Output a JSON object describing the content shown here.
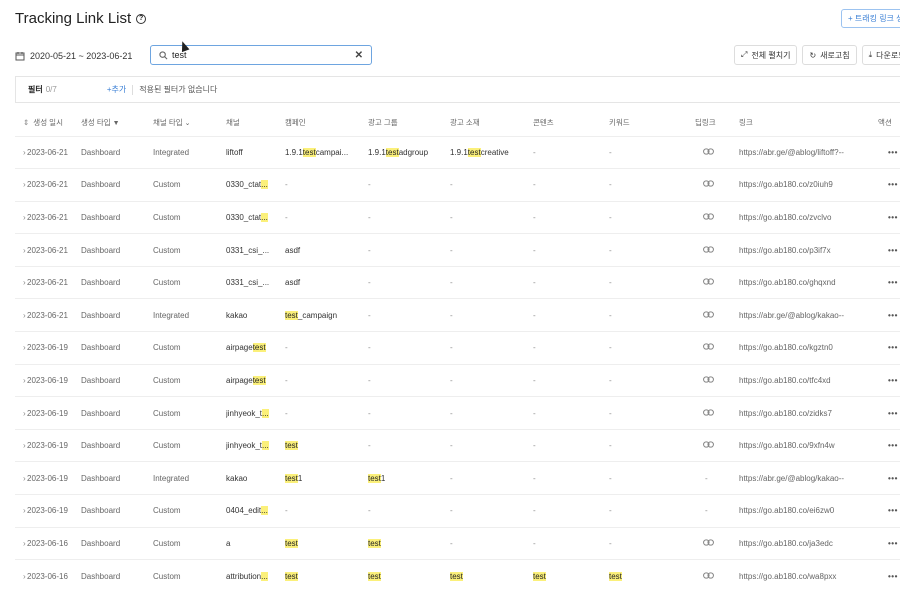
{
  "page": {
    "title": "Tracking Link List",
    "help_icon": "?"
  },
  "create_button": {
    "label": "+ 트래킹 링크 생"
  },
  "date_range": {
    "label": "2020-05-21  ~  2023-06-21"
  },
  "search": {
    "value": "test",
    "placeholder": ""
  },
  "toolbar": {
    "expand": "전체 펼치기",
    "refresh": "새로고침",
    "download": "다운로드"
  },
  "filter": {
    "label": "필터",
    "count": "0/7",
    "add": "+추가",
    "empty": "적용된 필터가 없습니다"
  },
  "columns": [
    "생성 일시",
    "생성 타입",
    "채널 타입",
    "채널",
    "캠페인",
    "광고 그룹",
    "광고 소재",
    "콘텐츠",
    "키워드",
    "딥링크",
    "링크",
    "액션"
  ],
  "rows": [
    {
      "date": "2023-06-21",
      "ctype": "Dashboard",
      "chtype": "Integrated",
      "channel": [
        "liftoff"
      ],
      "campaign": [
        "1.9.1",
        "test",
        "campai..."
      ],
      "group": [
        "1.9.1",
        "test",
        "adgroup"
      ],
      "creative": [
        "1.9.1",
        "test",
        "creative"
      ],
      "content": [
        "-"
      ],
      "keyword": [
        "-"
      ],
      "deeplink": "link",
      "url": "https://abr.ge/@ablog/liftoff?--",
      "action": "•••"
    },
    {
      "date": "2023-06-21",
      "ctype": "Dashboard",
      "chtype": "Custom",
      "channel": [
        "0330_ctat",
        "..."
      ],
      "campaign": [
        "-"
      ],
      "group": [
        "-"
      ],
      "creative": [
        "-"
      ],
      "content": [
        "-"
      ],
      "keyword": [
        "-"
      ],
      "deeplink": "link",
      "url": "https://go.ab180.co/z0iuh9",
      "action": "•••"
    },
    {
      "date": "2023-06-21",
      "ctype": "Dashboard",
      "chtype": "Custom",
      "channel": [
        "0330_ctat",
        "..."
      ],
      "campaign": [
        "-"
      ],
      "group": [
        "-"
      ],
      "creative": [
        "-"
      ],
      "content": [
        "-"
      ],
      "keyword": [
        "-"
      ],
      "deeplink": "link",
      "url": "https://go.ab180.co/zvclvo",
      "action": "•••"
    },
    {
      "date": "2023-06-21",
      "ctype": "Dashboard",
      "chtype": "Custom",
      "channel": [
        "0331_csi_..."
      ],
      "campaign": [
        "asdf"
      ],
      "group": [
        "-"
      ],
      "creative": [
        "-"
      ],
      "content": [
        "-"
      ],
      "keyword": [
        "-"
      ],
      "deeplink": "link",
      "url": "https://go.ab180.co/p3if7x",
      "action": "•••"
    },
    {
      "date": "2023-06-21",
      "ctype": "Dashboard",
      "chtype": "Custom",
      "channel": [
        "0331_csi_..."
      ],
      "campaign": [
        "asdf"
      ],
      "group": [
        "-"
      ],
      "creative": [
        "-"
      ],
      "content": [
        "-"
      ],
      "keyword": [
        "-"
      ],
      "deeplink": "link",
      "url": "https://go.ab180.co/ghqxnd",
      "action": "•••"
    },
    {
      "date": "2023-06-21",
      "ctype": "Dashboard",
      "chtype": "Integrated",
      "channel": [
        "kakao"
      ],
      "campaign": [
        "",
        "test",
        "_campaign"
      ],
      "group": [
        "-"
      ],
      "creative": [
        "-"
      ],
      "content": [
        "-"
      ],
      "keyword": [
        "-"
      ],
      "deeplink": "link",
      "url": "https://abr.ge/@ablog/kakao--",
      "action": "•••"
    },
    {
      "date": "2023-06-19",
      "ctype": "Dashboard",
      "chtype": "Custom",
      "channel": [
        "airpage",
        "test",
        ""
      ],
      "campaign": [
        "-"
      ],
      "group": [
        "-"
      ],
      "creative": [
        "-"
      ],
      "content": [
        "-"
      ],
      "keyword": [
        "-"
      ],
      "deeplink": "link",
      "url": "https://go.ab180.co/kgztn0",
      "action": "•••"
    },
    {
      "date": "2023-06-19",
      "ctype": "Dashboard",
      "chtype": "Custom",
      "channel": [
        "airpage",
        "test",
        ""
      ],
      "campaign": [
        "-"
      ],
      "group": [
        "-"
      ],
      "creative": [
        "-"
      ],
      "content": [
        "-"
      ],
      "keyword": [
        "-"
      ],
      "deeplink": "link",
      "url": "https://go.ab180.co/tfc4xd",
      "action": "•••"
    },
    {
      "date": "2023-06-19",
      "ctype": "Dashboard",
      "chtype": "Custom",
      "channel": [
        "jinhyeok_t",
        "..."
      ],
      "campaign": [
        "-"
      ],
      "group": [
        "-"
      ],
      "creative": [
        "-"
      ],
      "content": [
        "-"
      ],
      "keyword": [
        "-"
      ],
      "deeplink": "link",
      "url": "https://go.ab180.co/zidks7",
      "action": "•••"
    },
    {
      "date": "2023-06-19",
      "ctype": "Dashboard",
      "chtype": "Custom",
      "channel": [
        "jinhyeok_t",
        "..."
      ],
      "campaign": [
        "",
        "test",
        ""
      ],
      "group": [
        "-"
      ],
      "creative": [
        "-"
      ],
      "content": [
        "-"
      ],
      "keyword": [
        "-"
      ],
      "deeplink": "link",
      "url": "https://go.ab180.co/9xfn4w",
      "action": "•••"
    },
    {
      "date": "2023-06-19",
      "ctype": "Dashboard",
      "chtype": "Integrated",
      "channel": [
        "kakao"
      ],
      "campaign": [
        "",
        "test",
        "1"
      ],
      "group": [
        "",
        "test",
        "1"
      ],
      "creative": [
        "-"
      ],
      "content": [
        "-"
      ],
      "keyword": [
        "-"
      ],
      "deeplink": "-",
      "url": "https://abr.ge/@ablog/kakao--",
      "action": "•••"
    },
    {
      "date": "2023-06-19",
      "ctype": "Dashboard",
      "chtype": "Custom",
      "channel": [
        "0404_edit",
        "..."
      ],
      "campaign": [
        "-"
      ],
      "group": [
        "-"
      ],
      "creative": [
        "-"
      ],
      "content": [
        "-"
      ],
      "keyword": [
        "-"
      ],
      "deeplink": "-",
      "url": "https://go.ab180.co/ei6zw0",
      "action": "•••"
    },
    {
      "date": "2023-06-16",
      "ctype": "Dashboard",
      "chtype": "Custom",
      "channel": [
        "a"
      ],
      "campaign": [
        "",
        "test",
        ""
      ],
      "group": [
        "",
        "test",
        ""
      ],
      "creative": [
        "-"
      ],
      "content": [
        "-"
      ],
      "keyword": [
        "-"
      ],
      "deeplink": "link",
      "url": "https://go.ab180.co/ja3edc",
      "action": "•••"
    },
    {
      "date": "2023-06-16",
      "ctype": "Dashboard",
      "chtype": "Custom",
      "channel": [
        "attribution",
        "..."
      ],
      "campaign": [
        "",
        "test",
        ""
      ],
      "group": [
        "",
        "test",
        ""
      ],
      "creative": [
        "",
        "test",
        ""
      ],
      "content": [
        "",
        "test",
        ""
      ],
      "keyword": [
        "",
        "test",
        ""
      ],
      "deeplink": "link",
      "url": "https://go.ab180.co/wa8pxx",
      "action": "•••"
    }
  ]
}
